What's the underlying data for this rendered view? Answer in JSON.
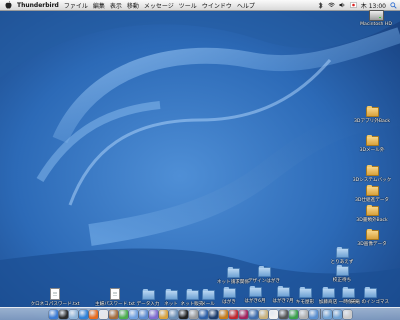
{
  "menubar": {
    "app": "Thunderbird",
    "items": [
      "ファイル",
      "編集",
      "表示",
      "移動",
      "メッセージ",
      "ツール",
      "ウインドウ",
      "ヘルプ"
    ],
    "clock": "木 13:00"
  },
  "desktop_icons": [
    {
      "label": "Macintosh HD",
      "kind": "hdd"
    },
    {
      "label": "3Dアプリ外Back",
      "kind": "orange"
    },
    {
      "label": "3Dメール外",
      "kind": "orange"
    },
    {
      "label": "3Dシステムバック",
      "kind": "orange"
    },
    {
      "label": "3D仕組進データ",
      "kind": "orange"
    },
    {
      "label": "3D書類外Back",
      "kind": "orange"
    },
    {
      "label": "3D画像データ",
      "kind": "orange"
    },
    {
      "label": "とりあえず",
      "kind": "blue"
    },
    {
      "label": "校正待ち",
      "kind": "blue"
    },
    {
      "label": "ネット請求関係",
      "kind": "blue"
    },
    {
      "label": "デザインはがき",
      "kind": "blue"
    },
    {
      "label": "クロネコパスワード.txt",
      "kind": "doc"
    },
    {
      "label": "主婦パスワード.txt",
      "kind": "doc"
    },
    {
      "label": "データ入力",
      "kind": "blue"
    },
    {
      "label": "ネット",
      "kind": "blue"
    },
    {
      "label": "ネット販売",
      "kind": "blue"
    },
    {
      "label": "メール",
      "kind": "blue"
    },
    {
      "label": "はがき",
      "kind": "blue"
    },
    {
      "label": "はがき6月",
      "kind": "blue"
    },
    {
      "label": "はがき7月",
      "kind": "blue"
    },
    {
      "label": "キモ屋形",
      "kind": "blue"
    },
    {
      "label": "加藤商店",
      "kind": "blue"
    },
    {
      "label": "一時保存",
      "kind": "blue"
    },
    {
      "label": "天竜 のインゴマス",
      "kind": "blue"
    }
  ],
  "dock_icons": [
    {
      "name": "finder-icon",
      "color": "#3a7bd5"
    },
    {
      "name": "dashboard-icon",
      "color": "#2b2b2b"
    },
    {
      "name": "mail-icon",
      "color": "#8fb4d8"
    },
    {
      "name": "safari-icon",
      "color": "#2f82d8"
    },
    {
      "name": "firefox-icon",
      "color": "#e86a1c"
    },
    {
      "name": "ical-icon",
      "color": "#e7e7e7"
    },
    {
      "name": "address-book-icon",
      "color": "#a66c3a"
    },
    {
      "name": "ichat-icon",
      "color": "#4cae4c"
    },
    {
      "name": "itunes-icon",
      "color": "#6fa0e0"
    },
    {
      "name": "iphoto-icon",
      "color": "#5c8bd0"
    },
    {
      "name": "imovie-icon",
      "color": "#7f6bd0"
    },
    {
      "name": "garageband-icon",
      "color": "#d9a23c"
    },
    {
      "name": "preview-icon",
      "color": "#6b8fb5"
    },
    {
      "name": "terminal-icon",
      "color": "#222222"
    },
    {
      "name": "system-preferences-icon",
      "color": "#9a9a9a"
    },
    {
      "name": "thunderbird-icon",
      "color": "#2c5fa8"
    },
    {
      "name": "photoshop-icon",
      "color": "#1c3c6c"
    },
    {
      "name": "illustrator-icon",
      "color": "#c77b17"
    },
    {
      "name": "acrobat-icon",
      "color": "#c0262d"
    },
    {
      "name": "indesign-icon",
      "color": "#a3215c"
    },
    {
      "name": "quark-icon",
      "color": "#3f6dad"
    },
    {
      "name": "font-book-icon",
      "color": "#c9b17a"
    },
    {
      "name": "textedit-icon",
      "color": "#f2f2f2"
    },
    {
      "name": "calculator-icon",
      "color": "#555555"
    },
    {
      "name": "activity-monitor-icon",
      "color": "#3aa04a"
    },
    {
      "name": "disk-utility-icon",
      "color": "#b0b0b0"
    },
    {
      "name": "network-icon",
      "color": "#5a8fd0"
    },
    {
      "name": "folder-icon",
      "color": "#6fa2d4"
    },
    {
      "name": "downloads-icon",
      "color": "#6fa2d4"
    },
    {
      "name": "trash-icon",
      "color": "#c9c9c9"
    }
  ]
}
